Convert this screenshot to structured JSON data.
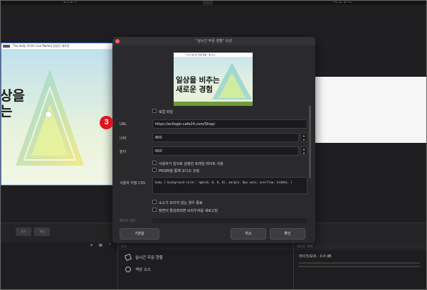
{
  "topbar": {
    "left_label": "ᄃᄂᄃᄀ",
    "right_label": "ᄀᄂᄃ ᄃᄀᄂ"
  },
  "scene_left": {
    "page_title": "The daily 라이브 Live Madrid 일상은 새로운",
    "headline_line1": "상을",
    "headline_line2": "는"
  },
  "dialog": {
    "title": "\"실시간 주문 현황\" 속성",
    "thumbnail": {
      "page_title": "Live 실시간 주문 현황 · 웹 소스",
      "headline_line1": "일상을 비추는",
      "headline_line2": "새로운 경험"
    },
    "local_file_label": "로컬 파일",
    "url_label": "URL",
    "url_value": "https://ecilogin.cafe24.com/Shop/",
    "width_label": "너비",
    "width_value": "800",
    "height_label": "높이",
    "height_value": "600",
    "custom_frame_rate_label": "사용자가 임의로 설정한 프레임 레이트 사용",
    "prism_audio_label": "PRISM을 통해 오디오 조정",
    "custom_css_label": "사용자 지정 CSS",
    "custom_css_value": "body { background-color: rgba(0, 0, 0, 0); margin: 0px auto; overflow: hidden; }",
    "shutdown_label": "소스가 보이지 않는 경우 종료",
    "refresh_label": "장면이 활성화되면 브라우저를 새로고침",
    "cutoff_label": "페이지 권한",
    "defaults_button": "기본값",
    "cancel_button": "취소",
    "ok_button": "확인"
  },
  "step_badge": "3",
  "dock": {
    "toolbar_btn1": "추가",
    "toolbar_btn2": "편집",
    "sources_header": "소스",
    "mixer_header": "오디오 믹서",
    "sources": [
      {
        "label": "실시간 주문 현황"
      },
      {
        "label": "색상 소스"
      }
    ],
    "mixer_track": "마이크/보조 · 0.0 dB"
  }
}
